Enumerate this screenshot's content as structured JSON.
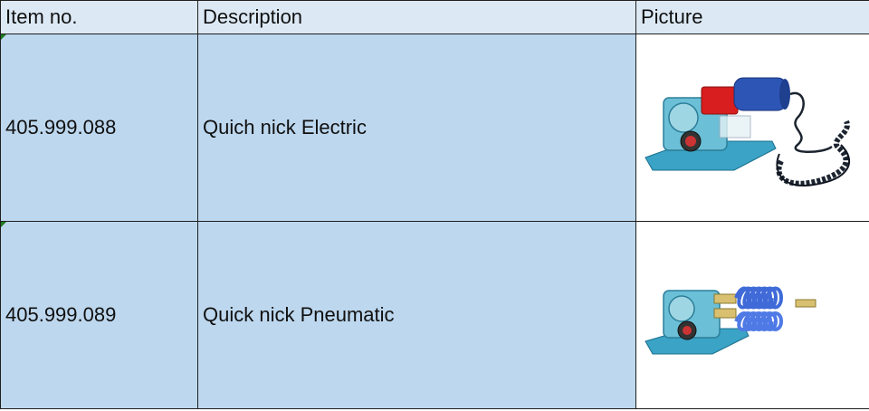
{
  "headers": {
    "item_no": "Item no.",
    "description": "Description",
    "picture": "Picture"
  },
  "rows": [
    {
      "item_no": "405.999.088",
      "description": "Quich nick Electric",
      "picture_icon": "electric-nick-tool-icon"
    },
    {
      "item_no": "405.999.089",
      "description": "Quick nick Pneumatic",
      "picture_icon": "pneumatic-nick-tool-icon"
    }
  ],
  "colors": {
    "header_bg": "#dce9f5",
    "cell_bg": "#bdd7ee",
    "border": "#1f1f1f"
  }
}
